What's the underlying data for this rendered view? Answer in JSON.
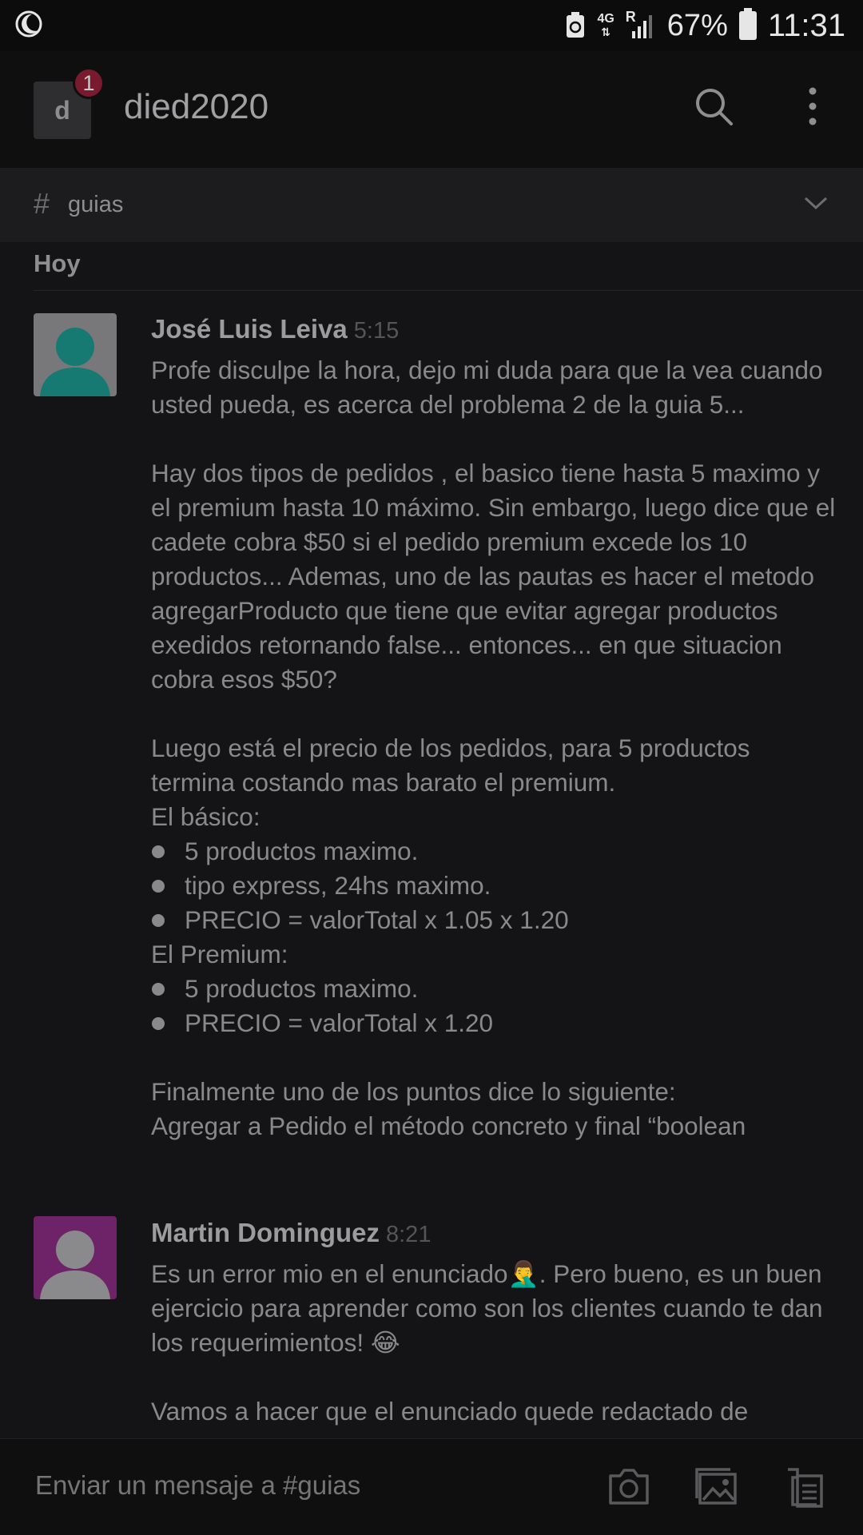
{
  "status": {
    "network": "4G",
    "roaming": "R",
    "battery": "67%",
    "time": "11:31"
  },
  "workspace": {
    "initial": "d",
    "badge": "1",
    "name": "died2020"
  },
  "channel": {
    "hash": "#",
    "name": "guias"
  },
  "day_label": "Hoy",
  "messages": [
    {
      "author": "José Luis Leiva",
      "time": "5:15",
      "avatar_color": "#167a72",
      "p1": "Profe disculpe la hora, dejo mi duda para que la vea cuando usted pueda, es acerca del problema 2 de la guia 5...",
      "p2": "Hay dos tipos de pedidos , el basico tiene hasta 5 maximo y el premium hasta 10 máximo. Sin embargo, luego dice que el cadete cobra $50 si el pedido premium excede los 10 productos... Ademas, uno de las pautas es hacer el metodo agregarProducto que tiene que evitar agregar productos exedidos retornando false... entonces... en que situacion cobra esos $50?",
      "p3": "Luego está el precio de los pedidos, para 5 productos termina costando mas barato el premium.",
      "basic_title": "El básico:",
      "basic_items": [
        "5 productos maximo.",
        "tipo express, 24hs maximo.",
        "PRECIO = valorTotal x 1.05 x 1.20"
      ],
      "premium_title": "El Premium:",
      "premium_items": [
        "5 productos maximo.",
        "PRECIO = valorTotal x 1.20"
      ],
      "p4": "Finalmente uno de los puntos dice lo siguiente:",
      "p5": "Agregar a Pedido el método concreto y final “boolean"
    },
    {
      "author": "Martin Dominguez",
      "time": "8:21",
      "avatar_color": "#6e2368",
      "p1": "Es un error mio en el enunciado🤦‍♂️. Pero bueno, es un buen ejercicio para aprender como son los clientes cuando te dan los requerimientos! 😂",
      "p2": "Vamos a hacer que el enunciado quede redactado de"
    }
  ],
  "composer": {
    "placeholder": "Enviar un mensaje a #guias"
  },
  "icons": [
    "moon-icon",
    "search-icon",
    "more-vertical-icon",
    "chevron-down-icon",
    "camera-icon",
    "gallery-icon",
    "files-icon"
  ]
}
